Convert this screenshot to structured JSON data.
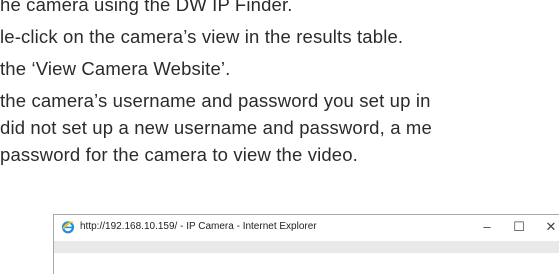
{
  "instructions": {
    "line1": "he camera using the DW IP Finder.",
    "line2": "le-click on the camera’s view in the results table.",
    "line3": " the ‘View Camera Website’.",
    "line4": " the camera’s username and password you set up in",
    "line5": " did not set up a new username and password, a me",
    "line6": " password for the camera to view the video."
  },
  "browser_window": {
    "title": "http://192.168.10.159/ - IP Camera - Internet Explorer",
    "minimize_glyph": "–",
    "maximize_glyph": "☐",
    "close_glyph": "✕",
    "app_icon": "internet-explorer-icon",
    "accent_color": "#1e90e0"
  }
}
